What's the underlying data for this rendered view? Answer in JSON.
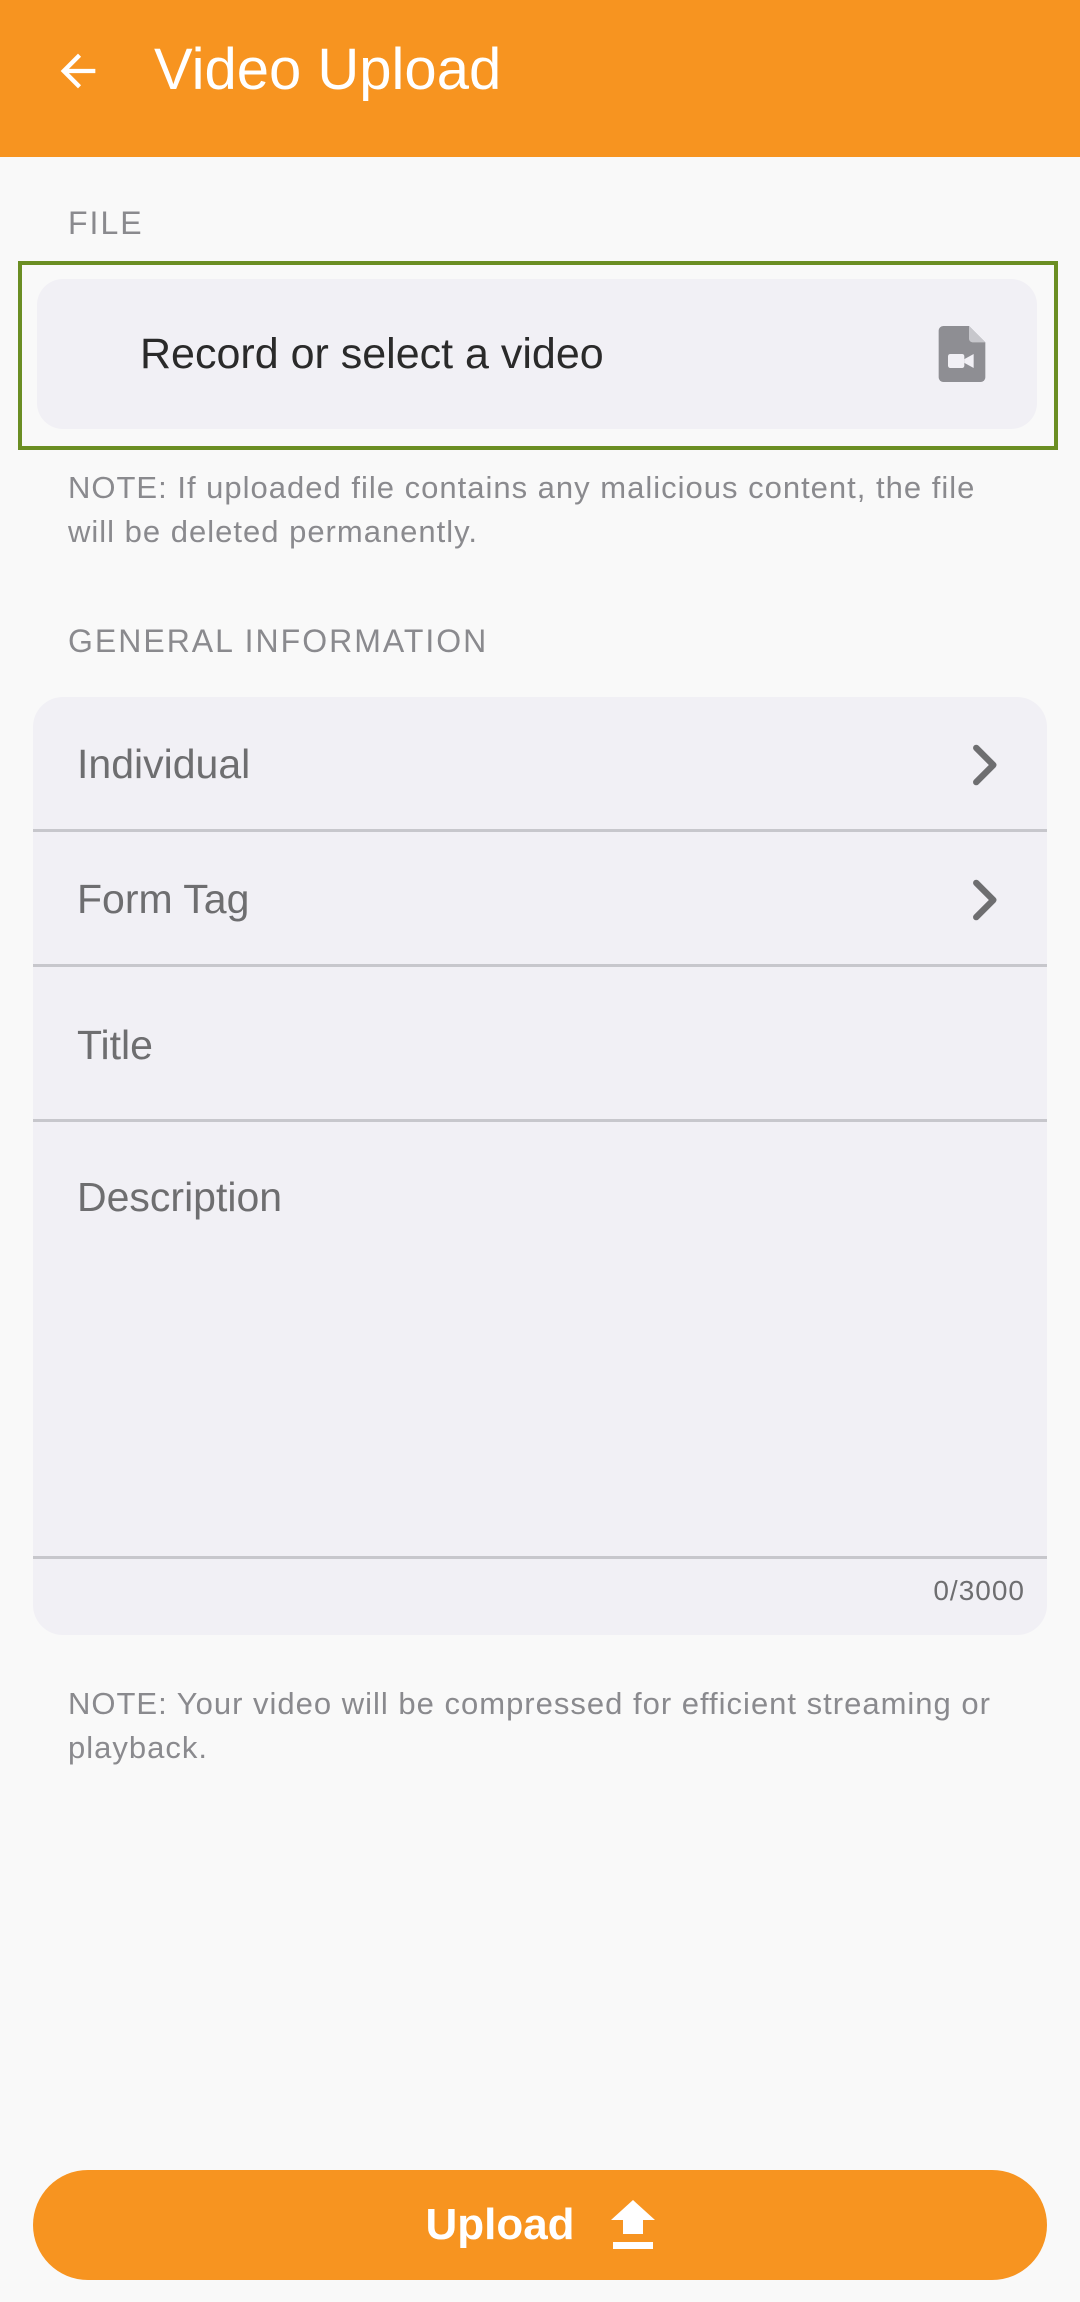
{
  "appbar": {
    "title": "Video Upload",
    "back_icon": "arrow-left-icon",
    "background_color": "#f79420"
  },
  "file_section": {
    "label": "FILE",
    "picker_label": "Record or select a video",
    "picker_icon": "video-file-icon",
    "note": "NOTE: If uploaded file contains any malicious content, the file will be deleted permanently."
  },
  "general_section": {
    "label": "GENERAL INFORMATION",
    "individual_label": "Individual",
    "form_tag_label": "Form Tag",
    "title_placeholder": "Title",
    "description_placeholder": "Description",
    "description_counter": "0/3000"
  },
  "footer_note": "NOTE: Your video will be compressed for efficient streaming or playback.",
  "upload_button": {
    "label": "Upload",
    "icon": "upload-arrow-icon",
    "color": "#f79420"
  },
  "highlight_color": "#6b8e23"
}
